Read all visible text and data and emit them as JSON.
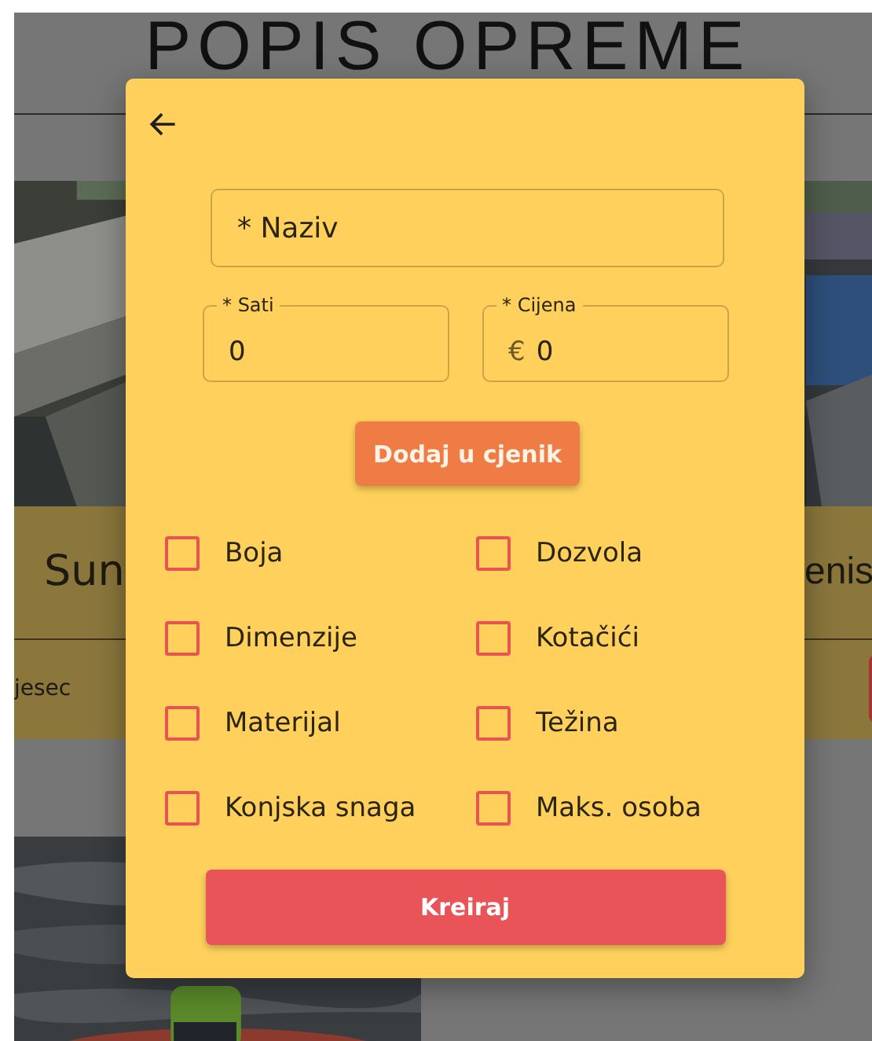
{
  "background": {
    "heading": "POPIS OPREME",
    "cards": [
      {
        "title": "Sun",
        "subtitle": "jesec"
      },
      {
        "title": "enis",
        "has_button": true
      }
    ]
  },
  "dialog": {
    "name_field": {
      "placeholder": "* Naziv"
    },
    "hours_field": {
      "label": "* Sati",
      "value": "0"
    },
    "price_field": {
      "label": "* Cijena",
      "prefix": "€",
      "value": "0"
    },
    "add_button": "Dodaj u cjenik",
    "options": [
      {
        "label": "Boja",
        "checked": false
      },
      {
        "label": "Dozvola",
        "checked": false
      },
      {
        "label": "Dimenzije",
        "checked": false
      },
      {
        "label": "Kotačići",
        "checked": false
      },
      {
        "label": "Materijal",
        "checked": false
      },
      {
        "label": "Težina",
        "checked": false
      },
      {
        "label": "Konjska snaga",
        "checked": false
      },
      {
        "label": "Maks. osoba",
        "checked": false
      }
    ],
    "submit_button": "Kreiraj"
  }
}
